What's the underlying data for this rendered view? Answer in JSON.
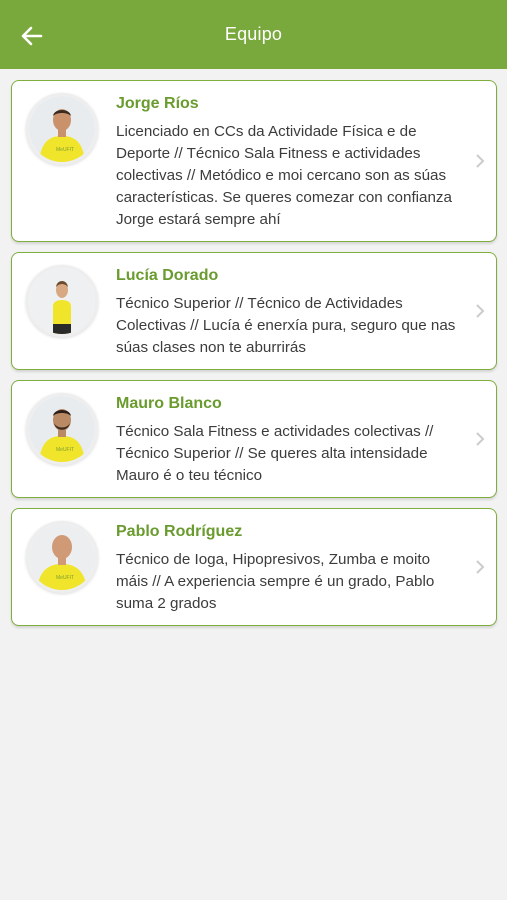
{
  "header": {
    "title": "Equipo",
    "back_icon": "arrow-left-icon",
    "background_color": "#79a93c"
  },
  "team": [
    {
      "name": "Jorge Ríos",
      "description": "Licenciado en CCs da Actividade Física e de Deporte // Técnico Sala Fitness e actividades colectivas // Metódico e moi cercano son as súas características. Se queres comezar con confianza Jorge estará sempre ahí"
    },
    {
      "name": "Lucía Dorado",
      "description": "Técnico Superior // Técnico de Actividades Colectivas // Lucía é enerxía pura, seguro que nas súas clases non te aburrirás"
    },
    {
      "name": "Mauro Blanco",
      "description": "Técnico Sala Fitness e actividades colectivas // Técnico Superior // Se queres alta intensidade Mauro é o teu técnico"
    },
    {
      "name": "Pablo Rodríguez",
      "description": "Técnico de Ioga, Hipopresivos, Zumba e moito máis // A experiencia sempre é un grado, Pablo suma 2 grados"
    }
  ],
  "colors": {
    "accent": "#79a93c",
    "name_text": "#6a9b2e",
    "shirt": "#f0e52a"
  }
}
